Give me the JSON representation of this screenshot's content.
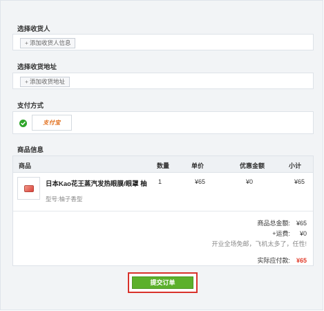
{
  "consignee": {
    "title": "选择收货人",
    "add_label": "添加收货人信息"
  },
  "address": {
    "title": "选择收货地址",
    "add_label": "添加收货地址"
  },
  "payment": {
    "title": "支付方式",
    "selected_method": "支付宝",
    "check_color": "#2ea52a"
  },
  "products": {
    "title": "商品信息",
    "columns": {
      "product": "商品",
      "quantity": "数量",
      "unit_price": "单价",
      "discount": "优惠金额",
      "subtotal": "小计"
    },
    "items": [
      {
        "name": "日本Kao花王蒸汽发热眼膜/眼罩 柚",
        "variant": "型号:柚子香型",
        "quantity": "1",
        "unit_price": "¥65",
        "discount": "¥0",
        "subtotal": "¥65"
      }
    ]
  },
  "summary": {
    "total_label": "商品总金额:",
    "total_value": "¥65",
    "shipping_label": "+运费:",
    "shipping_value": "¥0",
    "shipping_note": "开业全场免邮，飞机太多了，任性!",
    "payable_label": "实际应付款:",
    "payable_value": "¥65",
    "payable_color": "#e23b2a"
  },
  "submit": {
    "label": "提交订单",
    "button_color": "#5cb02b",
    "highlight_color": "#d8312a"
  }
}
